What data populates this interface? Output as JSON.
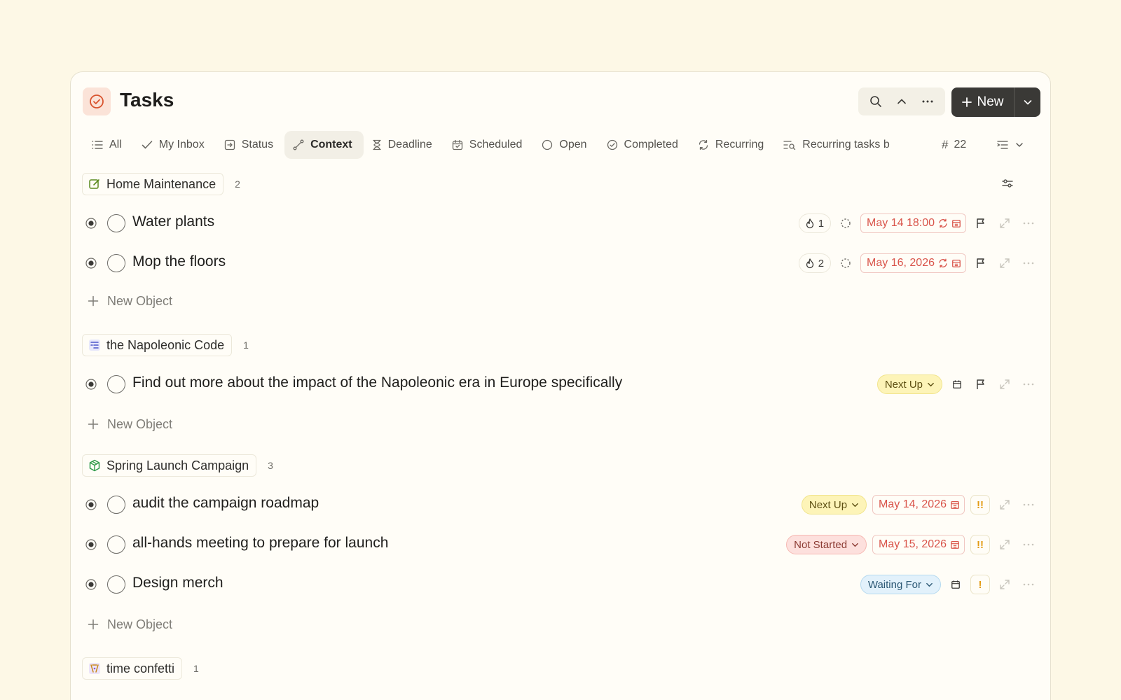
{
  "header": {
    "title": "Tasks",
    "app_icon": "check-circle-icon",
    "accent": "#d9542f",
    "new_label": "New"
  },
  "tabs": [
    {
      "label": "All",
      "icon": "list-icon"
    },
    {
      "label": "My Inbox",
      "icon": "checkmark-icon"
    },
    {
      "label": "Status",
      "icon": "box-arrow-icon"
    },
    {
      "label": "Context",
      "icon": "link-icon",
      "active": true
    },
    {
      "label": "Deadline",
      "icon": "hourglass-icon"
    },
    {
      "label": "Scheduled",
      "icon": "calendar-icon"
    },
    {
      "label": "Open",
      "icon": "circle-icon"
    },
    {
      "label": "Completed",
      "icon": "check-circle-icon"
    },
    {
      "label": "Recurring",
      "icon": "repeat-icon"
    },
    {
      "label": "Recurring tasks b",
      "icon": "list-search-icon"
    }
  ],
  "tab_count": "22",
  "groups": [
    {
      "name": "Home Maintenance",
      "count": "2",
      "icon_color": "#5a8a1f",
      "tasks": [
        {
          "title": "Water plants",
          "streak": "1",
          "date": "May 14 18:00"
        },
        {
          "title": "Mop the floors",
          "streak": "2",
          "date": "May 16, 2026"
        }
      ],
      "new_object_label": "New Object"
    },
    {
      "name": "the Napoleonic Code",
      "count": "1",
      "icon_color": "#4b55c9",
      "tasks": [
        {
          "title": "Find out more about the impact of the Napoleonic era in Europe specifically",
          "status": "Next Up"
        }
      ],
      "new_object_label": "New Object"
    },
    {
      "name": "Spring Launch Campaign",
      "count": "3",
      "icon_color": "#2f9a4a",
      "tasks": [
        {
          "title": "audit the campaign roadmap",
          "status": "Next Up",
          "date": "May 14, 2026",
          "priority": "!!"
        },
        {
          "title": "all-hands meeting to prepare for launch",
          "status": "Not Started",
          "date": "May 15, 2026",
          "priority": "!!"
        },
        {
          "title": "Design merch",
          "status": "Waiting For",
          "priority": "!"
        }
      ],
      "new_object_label": "New Object"
    },
    {
      "name": "time confetti",
      "count": "1",
      "icon_color": "#c98a1c"
    }
  ]
}
